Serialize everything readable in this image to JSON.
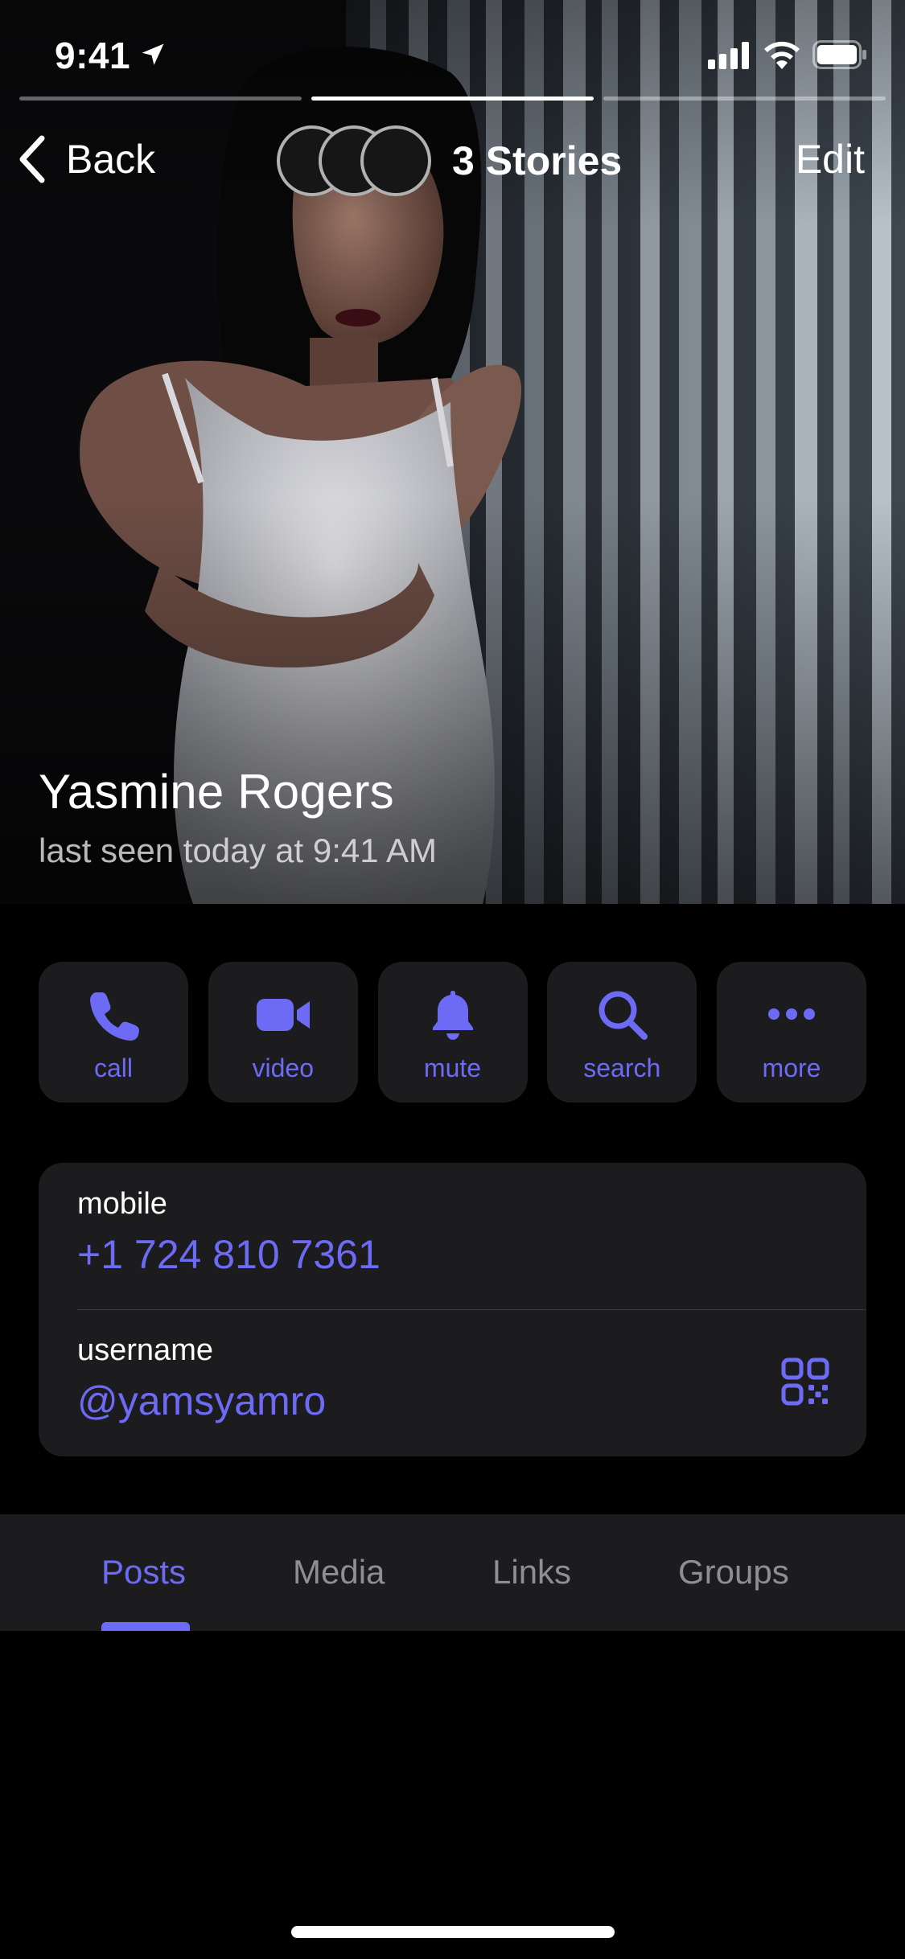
{
  "status_bar": {
    "time": "9:41"
  },
  "stories": {
    "count_label": "3 Stories",
    "segments": 3,
    "active_segment": 2
  },
  "nav": {
    "back_label": "Back",
    "edit_label": "Edit"
  },
  "profile": {
    "name": "Yasmine Rogers",
    "status": "last seen today at 9:41 AM"
  },
  "actions": [
    {
      "id": "call",
      "label": "call",
      "icon": "phone-icon"
    },
    {
      "id": "video",
      "label": "video",
      "icon": "video-camera-icon"
    },
    {
      "id": "mute",
      "label": "mute",
      "icon": "bell-icon"
    },
    {
      "id": "search",
      "label": "search",
      "icon": "search-icon"
    },
    {
      "id": "more",
      "label": "more",
      "icon": "more-dots-icon"
    }
  ],
  "info": {
    "mobile_label": "mobile",
    "mobile_value": "+1 724 810 7361",
    "username_label": "username",
    "username_value": "@yamsyamro"
  },
  "tabs": [
    {
      "label": "Posts",
      "active": true
    },
    {
      "label": "Media",
      "active": false
    },
    {
      "label": "Links",
      "active": false
    },
    {
      "label": "Groups",
      "active": false
    }
  ],
  "colors": {
    "accent": "#6d6bf5",
    "card_bg": "#1c1c1e",
    "background": "#000000",
    "secondary_text": "#8e8e93"
  }
}
